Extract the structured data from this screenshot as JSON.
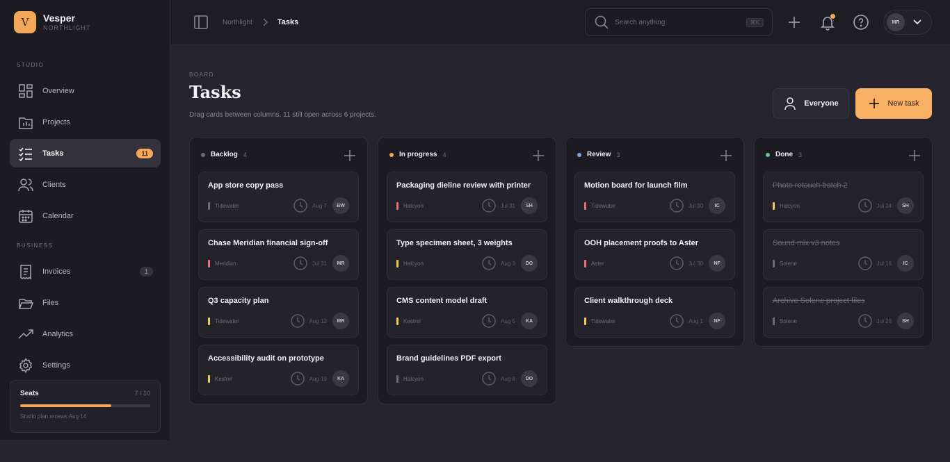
{
  "brand": {
    "initial": "V",
    "name": "Vesper",
    "workspace": "NORTHLIGHT"
  },
  "sidebar": {
    "studio_label": "STUDIO",
    "business_label": "BUSINESS",
    "items": [
      {
        "label": "Overview",
        "icon": "grid-icon"
      },
      {
        "label": "Projects",
        "icon": "folder-chart-icon"
      },
      {
        "label": "Tasks",
        "icon": "checklist-icon",
        "badge": "11",
        "active": true
      },
      {
        "label": "Clients",
        "icon": "users-icon"
      },
      {
        "label": "Calendar",
        "icon": "calendar-icon"
      },
      {
        "label": "Invoices",
        "icon": "receipt-icon",
        "badge": "1"
      },
      {
        "label": "Files",
        "icon": "folder-open-icon"
      },
      {
        "label": "Analytics",
        "icon": "trend-icon"
      },
      {
        "label": "Settings",
        "icon": "gear-icon"
      }
    ],
    "seats": {
      "title": "Seats",
      "count": "7 / 10",
      "fill": 0.7,
      "note": "Studio plan renews Aug 14"
    }
  },
  "topbar": {
    "breadcrumb_root": "Northlight",
    "breadcrumb_current": "Tasks",
    "search_placeholder": "Search anything",
    "search_shortcut": "⌘K",
    "user_initials": "MR"
  },
  "page": {
    "eyebrow": "BOARD",
    "title": "Tasks",
    "subtitle": "Drag cards between columns. 11 still open across 6 projects.",
    "filter_label": "Everyone",
    "new_task_label": "New task"
  },
  "colors": {
    "accent": "#f4a95a",
    "red": "#e7707a",
    "yellow": "#f2c94c",
    "gray": "#6e6b78",
    "blue": "#7aa7e0",
    "green": "#5ecb8a"
  },
  "columns": [
    {
      "name": "Backlog",
      "count": "4",
      "dot": "#6e6b78",
      "cards": [
        {
          "title": "App store copy pass",
          "project": "Tidewater",
          "bar": "#6e6b78",
          "due": "Aug 7",
          "assignee": "BW"
        },
        {
          "title": "Chase Meridian financial sign-off",
          "project": "Meridian",
          "bar": "#e7707a",
          "due": "Jul 31",
          "assignee": "MR"
        },
        {
          "title": "Q3 capacity plan",
          "project": "Tidewater",
          "bar": "#f2c94c",
          "due": "Aug 12",
          "assignee": "MR"
        },
        {
          "title": "Accessibility audit on prototype",
          "project": "Kestrel",
          "bar": "#f2c94c",
          "due": "Aug 19",
          "assignee": "KA"
        }
      ]
    },
    {
      "name": "In progress",
      "count": "4",
      "dot": "#f4a95a",
      "cards": [
        {
          "title": "Packaging dieline review with printer",
          "project": "Halcyon",
          "bar": "#e7707a",
          "due": "Jul 31",
          "assignee": "SH"
        },
        {
          "title": "Type specimen sheet, 3 weights",
          "project": "Halcyon",
          "bar": "#f2c94c",
          "due": "Aug 3",
          "assignee": "DO"
        },
        {
          "title": "CMS content model draft",
          "project": "Kestrel",
          "bar": "#f2c94c",
          "due": "Aug 5",
          "assignee": "KA"
        },
        {
          "title": "Brand guidelines PDF export",
          "project": "Halcyon",
          "bar": "#6e6b78",
          "due": "Aug 8",
          "assignee": "DO"
        }
      ]
    },
    {
      "name": "Review",
      "count": "3",
      "dot": "#7aa7e0",
      "cards": [
        {
          "title": "Motion board for launch film",
          "project": "Tidewater",
          "bar": "#e7707a",
          "due": "Jul 30",
          "assignee": "IC"
        },
        {
          "title": "OOH placement proofs to Aster",
          "project": "Aster",
          "bar": "#e7707a",
          "due": "Jul 30",
          "assignee": "NF"
        },
        {
          "title": "Client walkthrough deck",
          "project": "Tidewater",
          "bar": "#f2c94c",
          "due": "Aug 1",
          "assignee": "NF"
        }
      ]
    },
    {
      "name": "Done",
      "count": "3",
      "dot": "#5ecb8a",
      "done": true,
      "cards": [
        {
          "title": "Photo retouch batch 2",
          "project": "Halcyon",
          "bar": "#f2c94c",
          "due": "Jul 24",
          "assignee": "SH"
        },
        {
          "title": "Sound mix v3 notes",
          "project": "Solene",
          "bar": "#6e6b78",
          "due": "Jul 16",
          "assignee": "IC"
        },
        {
          "title": "Archive Solene project files",
          "project": "Solene",
          "bar": "#6e6b78",
          "due": "Jul 20",
          "assignee": "SH"
        }
      ]
    }
  ]
}
